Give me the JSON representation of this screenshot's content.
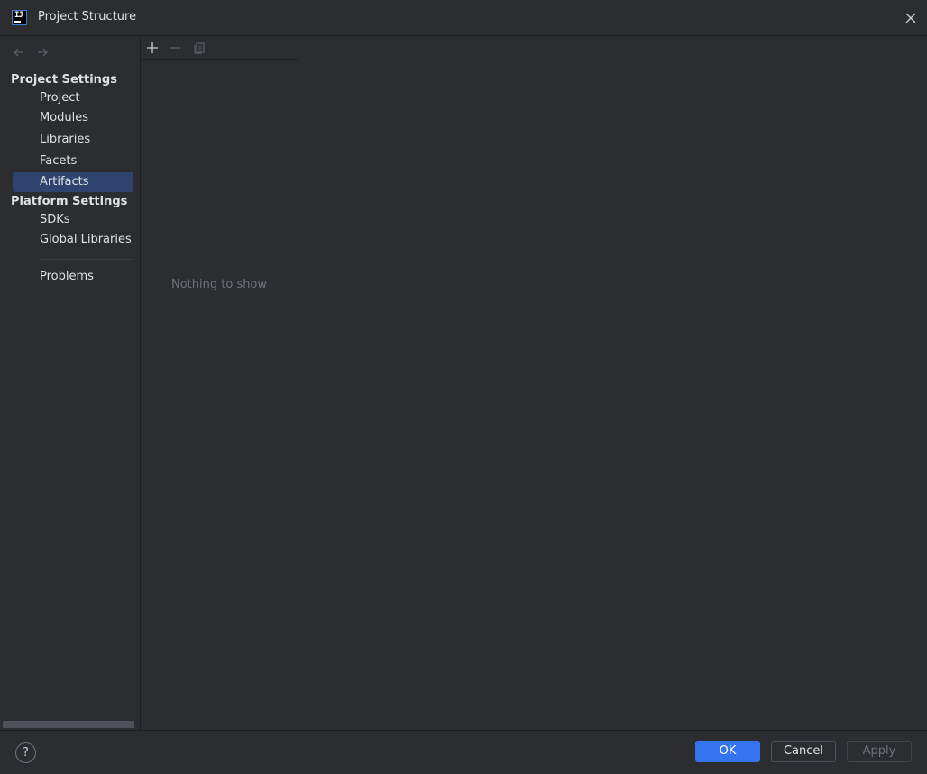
{
  "window": {
    "title": "Project Structure",
    "logo_text": "IJ"
  },
  "sidebar": {
    "project_settings_header": "Project Settings",
    "project_items": [
      {
        "label": "Project"
      },
      {
        "label": "Modules"
      },
      {
        "label": "Libraries"
      },
      {
        "label": "Facets"
      },
      {
        "label": "Artifacts",
        "selected": true
      }
    ],
    "platform_settings_header": "Platform Settings",
    "platform_items": [
      {
        "label": "SDKs"
      },
      {
        "label": "Global Libraries"
      }
    ],
    "other_items": [
      {
        "label": "Problems"
      }
    ]
  },
  "middle": {
    "empty_text": "Nothing to show",
    "toolbar_icons": [
      "add-icon",
      "remove-icon",
      "copy-icon"
    ]
  },
  "footer": {
    "help_label": "?",
    "ok_label": "OK",
    "cancel_label": "Cancel",
    "apply_label": "Apply"
  },
  "colors": {
    "background": "#2b2d30",
    "selection": "#2e436e",
    "primary_button": "#3574f0"
  }
}
